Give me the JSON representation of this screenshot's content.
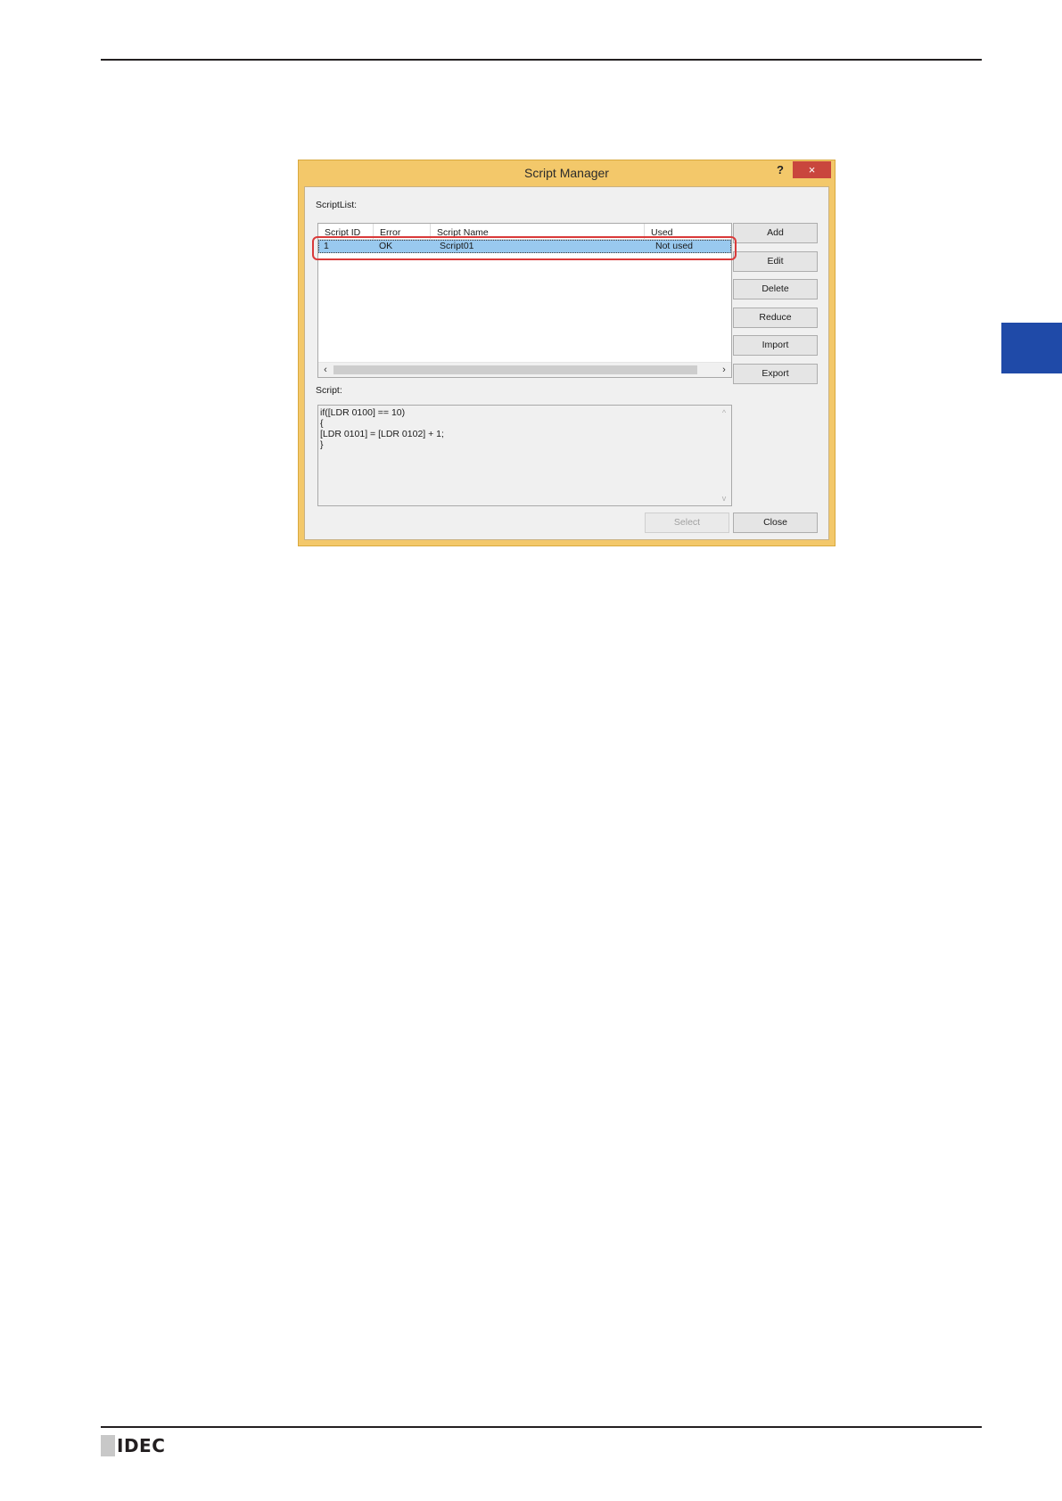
{
  "dialog": {
    "title": "Script Manager",
    "help_label": "?",
    "close_glyph": "×",
    "script_list_label": "ScriptList:",
    "script_label": "Script:"
  },
  "list": {
    "columns": [
      "Script ID",
      "Error",
      "Script Name",
      "Used"
    ],
    "rows": [
      {
        "id": "1",
        "error": "OK",
        "name": "Script01",
        "used": "Not used"
      }
    ],
    "scroll_left_glyph": "‹",
    "scroll_right_glyph": "›"
  },
  "buttons": {
    "add": "Add",
    "edit": "Edit",
    "delete": "Delete",
    "reduce": "Reduce",
    "import": "Import",
    "export": "Export",
    "select": "Select",
    "close": "Close"
  },
  "script": {
    "lines": [
      "if([LDR 0100] == 10)",
      "{",
      "[LDR 0101] = [LDR 0102] + 1;",
      "}"
    ],
    "scroll_up_glyph": "^",
    "scroll_down_glyph": "v"
  },
  "footer": {
    "logo_text": "IDEC"
  },
  "colors": {
    "title_bar": "#f3c86a",
    "close_button": "#c9463d",
    "selection": "#99c9ef",
    "highlight_outline": "#d93a3a",
    "side_tab": "#1f4aa8"
  }
}
